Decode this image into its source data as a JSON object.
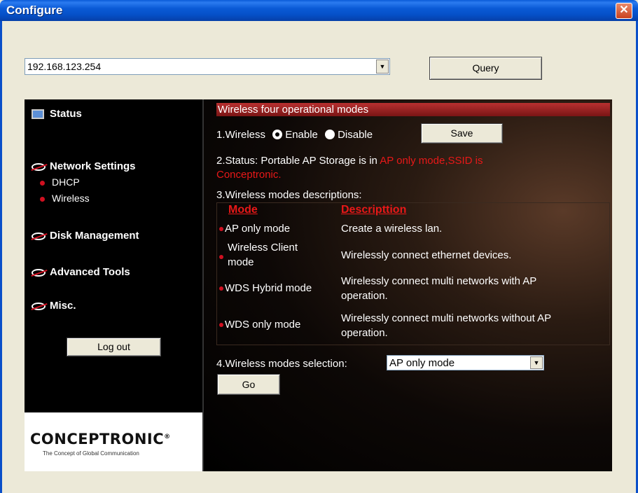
{
  "window": {
    "title": "Configure",
    "close_glyph": "✕"
  },
  "address": {
    "value": "192.168.123.254",
    "dropdown_glyph": "▼"
  },
  "query_label": "Query",
  "sidebar": {
    "status": "Status",
    "network_settings": "Network Settings",
    "dhcp": "DHCP",
    "wireless": "Wireless",
    "disk_management": "Disk Management",
    "advanced_tools": "Advanced Tools",
    "misc": "Misc.",
    "logout": "Log out",
    "logo": "CONCEPTRONIC",
    "logo_mark": "®",
    "tagline": "The Concept of Global Communication"
  },
  "content": {
    "banner": "Wireless four operational modes",
    "wireless_label": "1.Wireless",
    "enable_label": "Enable",
    "disable_label": "Disable",
    "enable_selected": true,
    "save_label": "Save",
    "status_prefix": "2.Status: Portable AP Storage is in ",
    "status_mode": "AP only mode,SSID is",
    "status_ssid": "Conceptronic.",
    "descriptions_title": "3.Wireless modes descriptions:",
    "col_mode": "Mode",
    "col_description": "Descripttion",
    "rows": [
      {
        "mode": "AP only mode",
        "description": "Create a wireless lan."
      },
      {
        "mode_line1": "Wireless Client",
        "mode_line2": "mode",
        "description": "Wirelessly connect ethernet devices."
      },
      {
        "mode": "WDS Hybrid mode",
        "description_line1": "Wirelessly connect multi networks with AP",
        "description_line2": "operation."
      },
      {
        "mode": "WDS only mode",
        "description_line1": "Wirelessly connect multi networks without AP",
        "description_line2": "operation."
      }
    ],
    "selection_label": "4.Wireless modes selection:",
    "selection_value": "AP only mode",
    "go_label": "Go"
  },
  "colors": {
    "accent_red": "#e81818",
    "titlebar_blue": "#0a5ad6"
  }
}
